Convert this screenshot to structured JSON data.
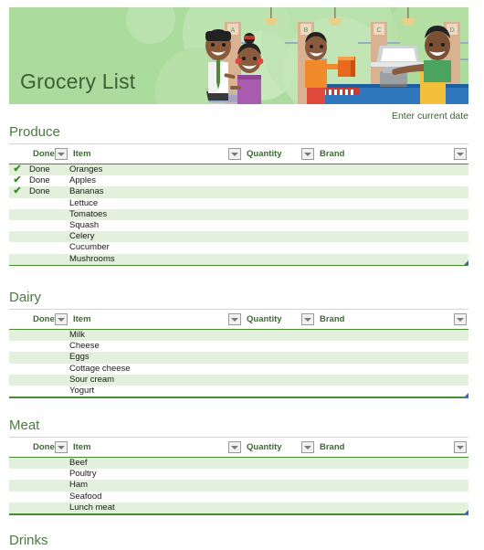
{
  "banner": {
    "title": "Grocery List",
    "bg_color": "#abdc9e",
    "title_color": "#3b6136"
  },
  "date_field": {
    "placeholder": "Enter current date"
  },
  "table_columns": [
    "Done",
    "Item",
    "Quantity",
    "Brand"
  ],
  "icons": {
    "filter": "filter-dropdown-icon",
    "check": "✔",
    "resize": "resize-handle-icon"
  },
  "sections": [
    {
      "title": "Produce",
      "rows": [
        {
          "check": "✔",
          "done": "Done",
          "item": "Oranges",
          "quantity": "",
          "brand": ""
        },
        {
          "check": "✔",
          "done": "Done",
          "item": "Apples",
          "quantity": "",
          "brand": ""
        },
        {
          "check": "✔",
          "done": "Done",
          "item": "Bananas",
          "quantity": "",
          "brand": ""
        },
        {
          "check": "",
          "done": "",
          "item": "Lettuce",
          "quantity": "",
          "brand": ""
        },
        {
          "check": "",
          "done": "",
          "item": "Tomatoes",
          "quantity": "",
          "brand": ""
        },
        {
          "check": "",
          "done": "",
          "item": "Squash",
          "quantity": "",
          "brand": ""
        },
        {
          "check": "",
          "done": "",
          "item": "Celery",
          "quantity": "",
          "brand": ""
        },
        {
          "check": "",
          "done": "",
          "item": "Cucumber",
          "quantity": "",
          "brand": ""
        },
        {
          "check": "",
          "done": "",
          "item": "Mushrooms",
          "quantity": "",
          "brand": ""
        }
      ]
    },
    {
      "title": "Dairy",
      "rows": [
        {
          "check": "",
          "done": "",
          "item": "Milk",
          "quantity": "",
          "brand": ""
        },
        {
          "check": "",
          "done": "",
          "item": "Cheese",
          "quantity": "",
          "brand": ""
        },
        {
          "check": "",
          "done": "",
          "item": "Eggs",
          "quantity": "",
          "brand": ""
        },
        {
          "check": "",
          "done": "",
          "item": "Cottage cheese",
          "quantity": "",
          "brand": ""
        },
        {
          "check": "",
          "done": "",
          "item": "Sour cream",
          "quantity": "",
          "brand": ""
        },
        {
          "check": "",
          "done": "",
          "item": "Yogurt",
          "quantity": "",
          "brand": ""
        }
      ]
    },
    {
      "title": "Meat",
      "rows": [
        {
          "check": "",
          "done": "",
          "item": "Beef",
          "quantity": "",
          "brand": ""
        },
        {
          "check": "",
          "done": "",
          "item": "Poultry",
          "quantity": "",
          "brand": ""
        },
        {
          "check": "",
          "done": "",
          "item": "Ham",
          "quantity": "",
          "brand": ""
        },
        {
          "check": "",
          "done": "",
          "item": "Seafood",
          "quantity": "",
          "brand": ""
        },
        {
          "check": "",
          "done": "",
          "item": "Lunch meat",
          "quantity": "",
          "brand": ""
        }
      ]
    },
    {
      "title": "Drinks",
      "rows": []
    }
  ]
}
